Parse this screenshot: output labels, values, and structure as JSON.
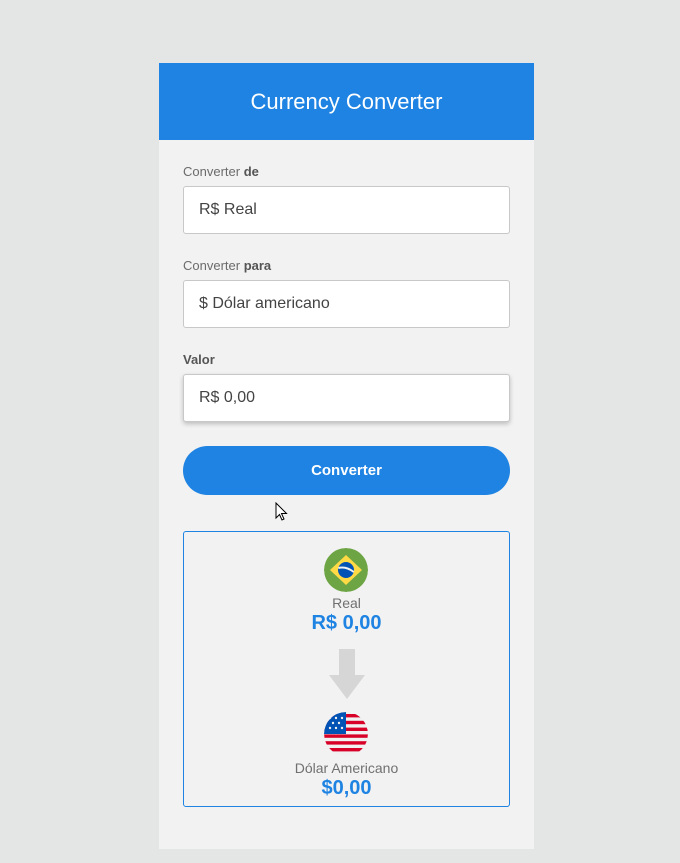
{
  "header": {
    "title": "Currency Converter"
  },
  "form": {
    "from": {
      "label_prefix": "Converter ",
      "label_emph": "de",
      "value": "R$ Real"
    },
    "to": {
      "label_prefix": "Converter ",
      "label_emph": "para",
      "value": "$ Dólar americano"
    },
    "amount": {
      "label": "Valor",
      "value": "R$ 0,00"
    },
    "submit_label": "Converter"
  },
  "result": {
    "from": {
      "flag_icon": "brazil-flag-icon",
      "name": "Real",
      "value": "R$ 0,00"
    },
    "arrow_icon": "arrow-down-icon",
    "to": {
      "flag_icon": "usa-flag-icon",
      "name": "Dólar Americano",
      "value": "$0,00"
    }
  },
  "colors": {
    "accent": "#1e83e2",
    "background": "#e4e5e5",
    "card": "#f2f2f2"
  }
}
